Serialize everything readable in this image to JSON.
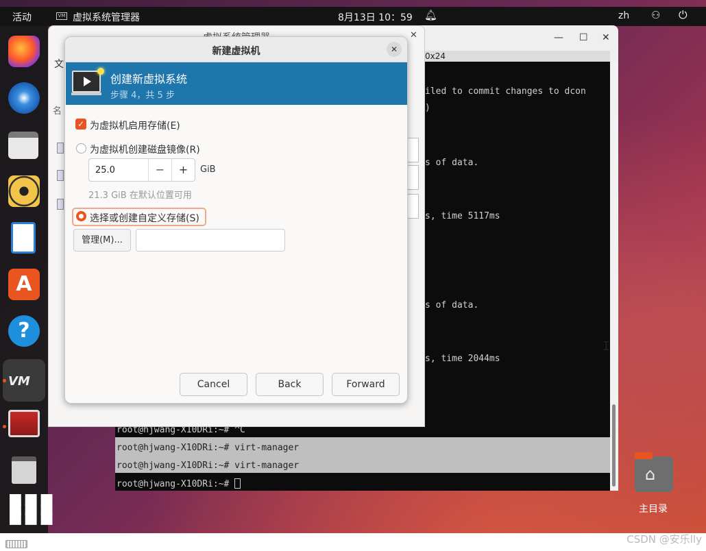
{
  "topbar": {
    "activities": "活动",
    "app_menu_icon": "VM",
    "app_name": "虚拟系统管理器",
    "clock": "8月13日 10：59",
    "language": "zh"
  },
  "terminal": {
    "size_label": "0x24",
    "lines": [
      "iled to commit changes to dcon",
      ")",
      "s of data.",
      "s, time 5117ms",
      "s of data.",
      "s, time 2044ms",
      "root@hjwang-X10DRi:~# ^C"
    ],
    "hl1_prompt": "root@hjwang-X10DRi:~# virt-man",
    "hl1_rest": "ager",
    "hl2": "root@hjwang-X10DRi:~# virt-manager",
    "last_prompt": "root@hjwang-X10DRi:~# "
  },
  "vmm_window": {
    "title": "虚拟系统管理器",
    "menu_file": "文",
    "name_column": "名"
  },
  "dialog": {
    "title": "新建虚拟机",
    "header_title": "创建新虚拟系统",
    "step": "步骤 4，共 5 步",
    "enable_storage": "为虚拟机启用存储(E)",
    "create_disk_image": "为虚拟机创建磁盘镜像(R)",
    "disk_size": "25.0",
    "disk_unit": "GiB",
    "free_space": "21.3 GiB 在默认位置可用",
    "custom_storage": "选择或创建自定义存储(S)",
    "manage_label": "管理(M)...",
    "custom_path_value": "",
    "cancel": "Cancel",
    "back": "Back",
    "forward": "Forward"
  },
  "desktop": {
    "home_folder_label": "主目录"
  },
  "watermark": "CSDN @安乐lly",
  "colors": {
    "accent": "#e95420",
    "header_blue": "#1e76ad"
  }
}
